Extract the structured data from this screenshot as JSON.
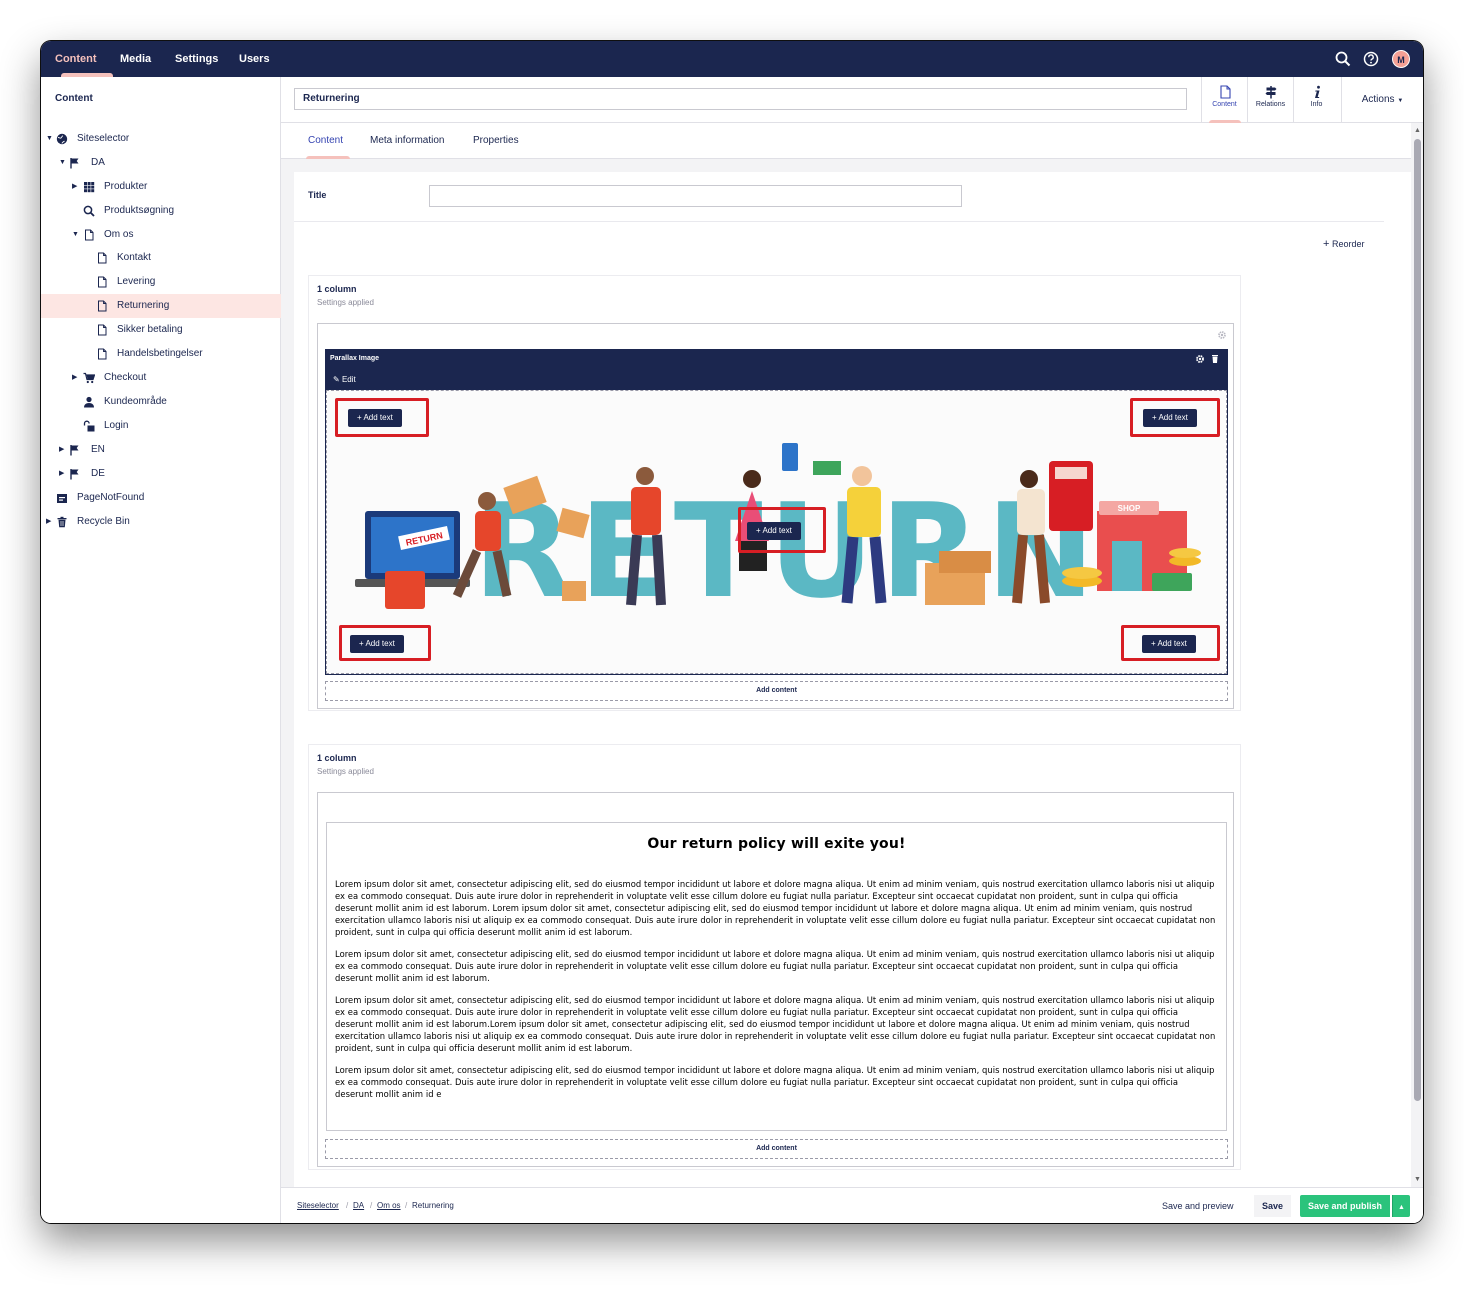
{
  "topnav": {
    "sections": [
      "Content",
      "Media",
      "Settings",
      "Users"
    ],
    "avatar": "M"
  },
  "sidebar": {
    "title": "Content",
    "tree": [
      {
        "label": "Siteselector",
        "icon": "globe-icon"
      },
      {
        "label": "DA",
        "icon": "flag-icon"
      },
      {
        "label": "Produkter",
        "icon": "grid-icon"
      },
      {
        "label": "Produktsøgning",
        "icon": "search-icon"
      },
      {
        "label": "Om os",
        "icon": "document-icon"
      },
      {
        "label": "Kontakt",
        "icon": "document-icon"
      },
      {
        "label": "Levering",
        "icon": "document-icon"
      },
      {
        "label": "Returnering",
        "icon": "document-icon"
      },
      {
        "label": "Sikker betaling",
        "icon": "document-icon"
      },
      {
        "label": "Handelsbetingelser",
        "icon": "document-icon"
      },
      {
        "label": "Checkout",
        "icon": "cart-icon"
      },
      {
        "label": "Kundeområde",
        "icon": "user-icon"
      },
      {
        "label": "Login",
        "icon": "unlock-icon"
      },
      {
        "label": "EN",
        "icon": "flag-icon"
      },
      {
        "label": "DE",
        "icon": "flag-icon"
      },
      {
        "label": "PageNotFound",
        "icon": "calendar-icon"
      },
      {
        "label": "Recycle Bin",
        "icon": "trash-icon"
      }
    ]
  },
  "header": {
    "node_name": "Returnering",
    "apps": [
      "Content",
      "Relations",
      "Info"
    ],
    "actions_label": "Actions"
  },
  "tabs": [
    "Content",
    "Meta information",
    "Properties"
  ],
  "editor": {
    "title_label": "Title",
    "title_value": "",
    "reorder_label": "Reorder",
    "sections": [
      {
        "title": "1 column",
        "subtitle": "Settings applied",
        "block_title": "Parallax Image",
        "edit_label": "Edit",
        "image_text": "RETURN",
        "image_sign": "SHOP",
        "add_text_label": "Add text",
        "add_content_label": "Add content"
      },
      {
        "title": "1 column",
        "subtitle": "Settings applied",
        "heading": "Our return policy will exite you!",
        "paragraphs": [
          "Lorem ipsum dolor sit amet, consectetur adipiscing elit, sed do eiusmod tempor incididunt ut labore et dolore magna aliqua. Ut enim ad minim veniam, quis nostrud exercitation ullamco laboris nisi ut aliquip ex ea commodo consequat. Duis aute irure dolor in reprehenderit in voluptate velit esse cillum dolore eu fugiat nulla pariatur. Excepteur sint occaecat cupidatat non proident, sunt in culpa qui officia deserunt mollit anim id est laborum. Lorem ipsum dolor sit amet, consectetur adipiscing elit, sed do eiusmod tempor incididunt ut labore et dolore magna aliqua. Ut enim ad minim veniam, quis nostrud exercitation ullamco laboris nisi ut aliquip ex ea commodo consequat. Duis aute irure dolor in reprehenderit in voluptate velit esse cillum dolore eu fugiat nulla pariatur. Excepteur sint occaecat cupidatat non proident, sunt in culpa qui officia deserunt mollit anim id est laborum.",
          "Lorem ipsum dolor sit amet, consectetur adipiscing elit, sed do eiusmod tempor incididunt ut labore et dolore magna aliqua. Ut enim ad minim veniam, quis nostrud exercitation ullamco laboris nisi ut aliquip ex ea commodo consequat. Duis aute irure dolor in reprehenderit in voluptate velit esse cillum dolore eu fugiat nulla pariatur. Excepteur sint occaecat cupidatat non proident, sunt in culpa qui officia deserunt mollit anim id est laborum.",
          "Lorem ipsum dolor sit amet, consectetur adipiscing elit, sed do eiusmod tempor incididunt ut labore et dolore magna aliqua. Ut enim ad minim veniam, quis nostrud exercitation ullamco laboris nisi ut aliquip ex ea commodo consequat. Duis aute irure dolor in reprehenderit in voluptate velit esse cillum dolore eu fugiat nulla pariatur. Excepteur sint occaecat cupidatat non proident, sunt in culpa qui officia deserunt mollit anim id est laborum.Lorem ipsum dolor sit amet, consectetur adipiscing elit, sed do eiusmod tempor incididunt ut labore et dolore magna aliqua. Ut enim ad minim veniam, quis nostrud exercitation ullamco laboris nisi ut aliquip ex ea commodo consequat. Duis aute irure dolor in reprehenderit in voluptate velit esse cillum dolore eu fugiat nulla pariatur. Excepteur sint occaecat cupidatat non proident, sunt in culpa qui officia deserunt mollit anim id est laborum.",
          "Lorem ipsum dolor sit amet, consectetur adipiscing elit, sed do eiusmod tempor incididunt ut labore et dolore magna aliqua. Ut enim ad minim veniam, quis nostrud exercitation ullamco laboris nisi ut aliquip ex ea commodo consequat. Duis aute irure dolor in reprehenderit in voluptate velit esse cillum dolore eu fugiat nulla pariatur. Excepteur sint occaecat cupidatat non proident, sunt in culpa qui officia deserunt mollit anim id e"
        ],
        "add_content_label": "Add content"
      }
    ]
  },
  "footer": {
    "breadcrumb": [
      "Siteselector",
      "DA",
      "Om os",
      "Returnering"
    ],
    "save_preview_label": "Save and preview",
    "save_label": "Save",
    "publish_label": "Save and publish"
  },
  "colors": {
    "header_bg": "#1b264f",
    "accent_pink": "#f5c1bc",
    "publish_green": "#2bc37c",
    "highlight_red": "#d71e24",
    "selected_bg": "#fde6e3"
  }
}
